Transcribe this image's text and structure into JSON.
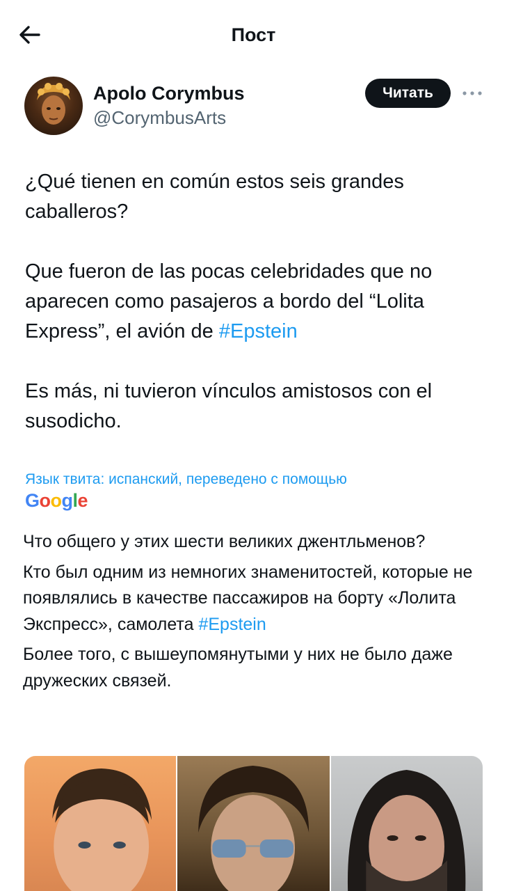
{
  "header": {
    "title": "Пост"
  },
  "author": {
    "name": "Apolo Corymbus",
    "handle": "@CorymbusArts",
    "follow_label": "Читать"
  },
  "tweet": {
    "p1": "¿Qué tienen en común estos seis grandes caballeros?",
    "p2_text": "Que fueron de las pocas celebridades que no aparecen como pasajeros a bordo del “Lolita Express”, el avión de ",
    "p2_hashtag": "#Epstein",
    "p3": "Es más, ni tuvieron vínculos amistosos con el susodicho."
  },
  "translation": {
    "label": "Язык твита: испанский, переведено с помощью",
    "provider": "Google",
    "t1": "Что общего у этих шести великих джентльменов?",
    "t2_text": "Кто был одним из немногих знаменитостей, которые не появлялись в качестве пассажиров на борту «Лолита Экспресс», самолета ",
    "t2_hashtag": "#Epstein",
    "t3": "Более того, с вышеупомянутыми у них не было даже дружеских связей."
  },
  "colors": {
    "accent": "#1d9bf0",
    "text": "#0f1419",
    "secondary": "#536471"
  },
  "icons": {
    "back": "arrow-left-icon",
    "more": "more-horizontal-icon"
  }
}
